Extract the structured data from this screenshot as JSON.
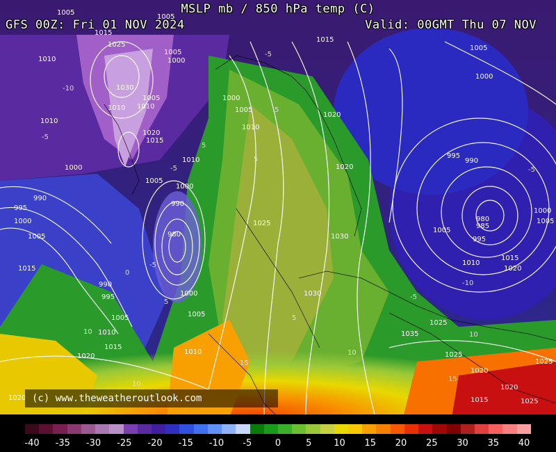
{
  "header": {
    "title": "MSLP mb / 850 hPa temp (C)",
    "run": "GFS 00Z: Fri 01 NOV 2024",
    "valid": "Valid: 00GMT Thu 07 NOV"
  },
  "credit": "(c) www.theweatheroutlook.com",
  "colorbar": {
    "ticks": [
      "-40",
      "-35",
      "-30",
      "-25",
      "-20",
      "-15",
      "-10",
      "-5",
      "0",
      "5",
      "10",
      "15",
      "20",
      "25",
      "30",
      "35",
      "40"
    ],
    "colors": [
      "#3a0a1a",
      "#5a1030",
      "#7a2050",
      "#8a3a70",
      "#9a5a90",
      "#a878b0",
      "#b890c8",
      "#7a40b0",
      "#5a2aa0",
      "#4020a0",
      "#3030c0",
      "#3050e0",
      "#4070f0",
      "#6090f8",
      "#90b0f8",
      "#c8d8f8",
      "#0a7a0a",
      "#1a9a1a",
      "#3ab02a",
      "#6ac030",
      "#9ac838",
      "#c8d040",
      "#e8d800",
      "#f8c800",
      "#f8a000",
      "#f88000",
      "#f85800",
      "#e83000",
      "#c81010",
      "#a00808",
      "#800000",
      "#b02020",
      "#e04040",
      "#f86060",
      "#f88080",
      "#f8a0a0"
    ]
  },
  "map": {
    "isobar_labels": [
      "1005",
      "1005",
      "1015",
      "1025",
      "1030",
      "1010",
      "1010",
      "1010",
      "1010",
      "1020",
      "1015",
      "1005",
      "1005",
      "1000",
      "1000",
      "1010",
      "1000",
      "1000",
      "990",
      "995",
      "1000",
      "1005",
      "1015",
      "980",
      "990",
      "1000",
      "1005",
      "1010",
      "1025",
      "1030",
      "1020",
      "1020",
      "1015",
      "1005",
      "1000",
      "995",
      "990",
      "980",
      "985",
      "995",
      "1005",
      "1010",
      "1015",
      "1020",
      "1000",
      "1005",
      "1030",
      "1035",
      "1025",
      "1025",
      "1020",
      "1025",
      "1015",
      "1020",
      "1025",
      "1020",
      "990",
      "995",
      "1005",
      "1010",
      "1015",
      "1020",
      "1005",
      "1010",
      "1005"
    ],
    "temp_labels": [
      "-5",
      "-5",
      "-5",
      "5",
      "5",
      "5",
      "5",
      "10",
      "10",
      "15",
      "15",
      "-5",
      "-5",
      "-5",
      "-10",
      "-10",
      "5",
      "0",
      "10",
      "10"
    ]
  }
}
